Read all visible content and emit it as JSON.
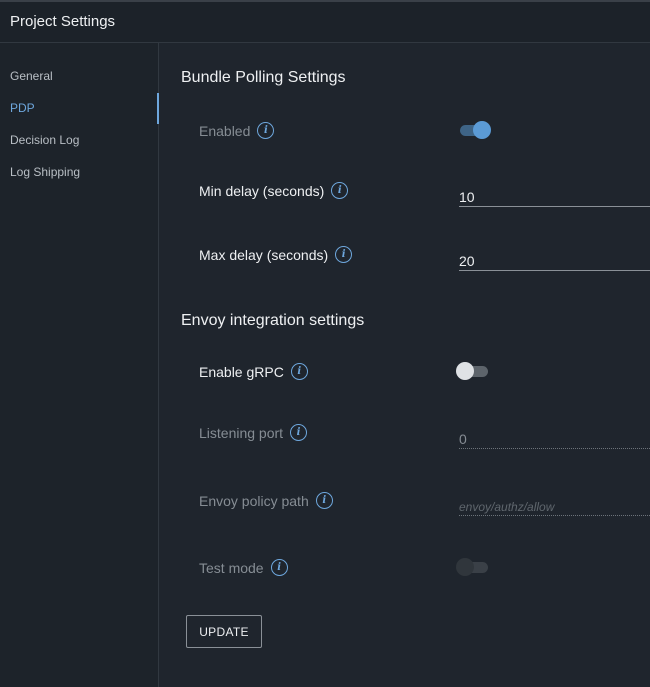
{
  "header": {
    "title": "Project Settings"
  },
  "sidebar": {
    "items": [
      {
        "label": "General",
        "active": false
      },
      {
        "label": "PDP",
        "active": true
      },
      {
        "label": "Decision Log",
        "active": false
      },
      {
        "label": "Log Shipping",
        "active": false
      }
    ]
  },
  "bundle_polling": {
    "title": "Bundle Polling Settings",
    "enabled": {
      "label": "Enabled",
      "state": "on",
      "disabled": true
    },
    "min_delay": {
      "label": "Min delay (seconds)",
      "value": "10"
    },
    "max_delay": {
      "label": "Max delay (seconds)",
      "value": "20"
    }
  },
  "envoy": {
    "title": "Envoy integration settings",
    "enable_grpc": {
      "label": "Enable gRPC",
      "state": "off"
    },
    "listening_port": {
      "label": "Listening port",
      "value": "0",
      "disabled": true
    },
    "policy_path": {
      "label": "Envoy policy path",
      "placeholder": "envoy/authz/allow",
      "disabled": true
    },
    "test_mode": {
      "label": "Test mode",
      "state": "off",
      "disabled": true
    }
  },
  "actions": {
    "update_label": "UPDATE"
  },
  "icons": {
    "info": "info-icon"
  },
  "colors": {
    "accent": "#6ea7dd",
    "background": "#1f252d",
    "toggle_on": "#5b9bd6"
  }
}
